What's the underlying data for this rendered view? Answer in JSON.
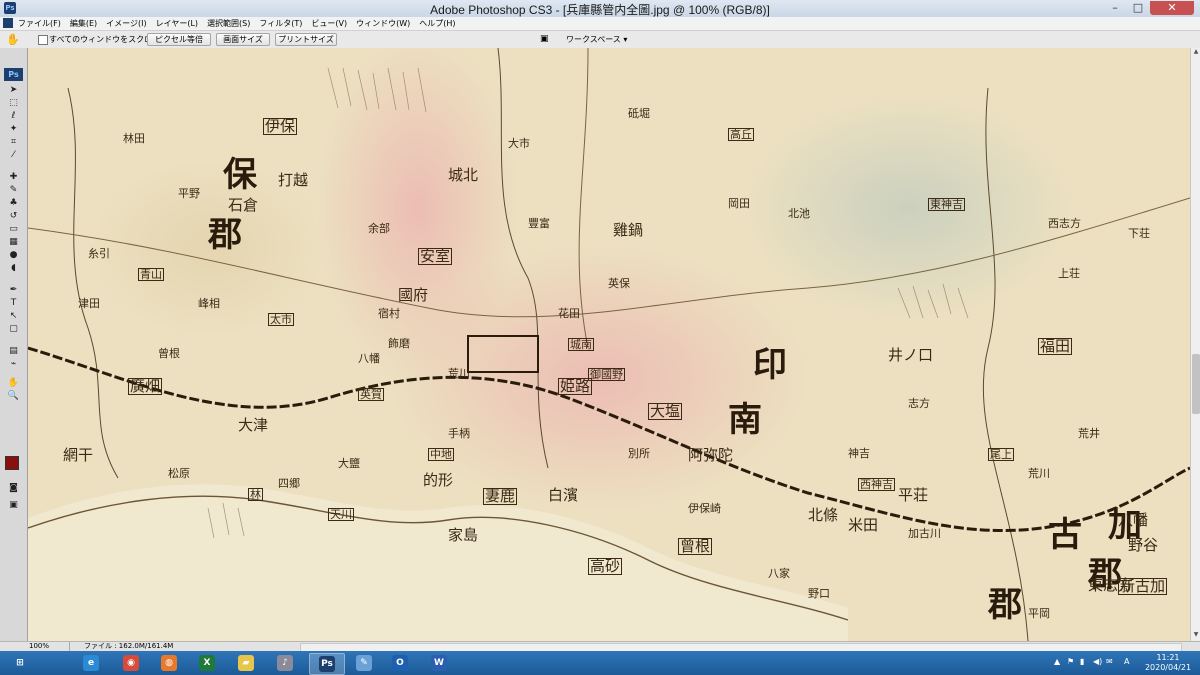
{
  "window": {
    "title": "Adobe Photoshop CS3 - [兵庫縣管内全圖.jpg @ 100% (RGB/8)]",
    "min_glyph": "–",
    "max_glyph": "□",
    "close_glyph": "✕"
  },
  "menubar": {
    "items": [
      "ファイル(F)",
      "編集(E)",
      "イメージ(I)",
      "レイヤー(L)",
      "選択範囲(S)",
      "フィルタ(T)",
      "ビュー(V)",
      "ウィンドウ(W)",
      "ヘルプ(H)"
    ]
  },
  "options": {
    "scroll_all_label": "すべてのウィンドウをスクロール",
    "actual_pixels": "ピクセル等倍",
    "fit_screen": "画面サイズ",
    "print_size": "プリントサイズ",
    "workspace": "ワークスペース ▾"
  },
  "tools": {
    "ps_logo": "Ps",
    "items": [
      {
        "name": "move-tool-icon",
        "glyph": "➤"
      },
      {
        "name": "marquee-tool-icon",
        "glyph": "⬚"
      },
      {
        "name": "lasso-tool-icon",
        "glyph": "ℓ"
      },
      {
        "name": "magic-wand-icon",
        "glyph": "✦"
      },
      {
        "name": "crop-tool-icon",
        "glyph": "⌗"
      },
      {
        "name": "slice-tool-icon",
        "glyph": "⁄"
      },
      {
        "name": "healing-brush-icon",
        "glyph": "✚"
      },
      {
        "name": "brush-tool-icon",
        "glyph": "✎"
      },
      {
        "name": "clone-stamp-icon",
        "glyph": "♣"
      },
      {
        "name": "history-brush-icon",
        "glyph": "↺"
      },
      {
        "name": "eraser-tool-icon",
        "glyph": "▭"
      },
      {
        "name": "gradient-tool-icon",
        "glyph": "▦"
      },
      {
        "name": "blur-tool-icon",
        "glyph": "●"
      },
      {
        "name": "dodge-tool-icon",
        "glyph": "◖"
      },
      {
        "name": "pen-tool-icon",
        "glyph": "✒"
      },
      {
        "name": "type-tool-icon",
        "glyph": "T"
      },
      {
        "name": "path-select-icon",
        "glyph": "↖"
      },
      {
        "name": "shape-tool-icon",
        "glyph": "▢"
      },
      {
        "name": "notes-tool-icon",
        "glyph": "▤"
      },
      {
        "name": "eyedropper-icon",
        "glyph": "⌁"
      },
      {
        "name": "hand-tool-icon",
        "glyph": "✋"
      },
      {
        "name": "zoom-tool-icon",
        "glyph": "🔍"
      }
    ],
    "bottom": [
      {
        "name": "quick-mask-icon",
        "glyph": "◙"
      },
      {
        "name": "screen-mode-icon",
        "glyph": "▣"
      }
    ],
    "foreground_color": "#8a1010",
    "background_color": "#ffffff"
  },
  "status": {
    "zoom": "100%",
    "file_info": "ファイル : 162.0M/161.4M"
  },
  "taskbar": {
    "apps": [
      {
        "name": "start-button",
        "glyph": "⊞",
        "color": "transparent",
        "active": false
      },
      {
        "name": "ie-icon",
        "glyph": "e",
        "color": "#2a8ad6",
        "active": false
      },
      {
        "name": "chrome-icon",
        "glyph": "◉",
        "color": "#d84a3a",
        "active": false
      },
      {
        "name": "firefox-icon",
        "glyph": "◍",
        "color": "#e8782a",
        "active": false
      },
      {
        "name": "excel-icon",
        "glyph": "X",
        "color": "#1f7a3a",
        "active": false
      },
      {
        "name": "explorer-icon",
        "glyph": "▰",
        "color": "#e8c64a",
        "active": false
      },
      {
        "name": "itunes-icon",
        "glyph": "♪",
        "color": "#8a8a9a",
        "active": false
      },
      {
        "name": "photoshop-icon",
        "glyph": "Ps",
        "color": "#1c3f6e",
        "active": true
      },
      {
        "name": "paint-icon",
        "glyph": "✎",
        "color": "#6aa2d8",
        "active": false
      },
      {
        "name": "outlook-icon",
        "glyph": "O",
        "color": "#1f5fb0",
        "active": false
      },
      {
        "name": "word-icon",
        "glyph": "W",
        "color": "#2b5fb0",
        "active": false
      }
    ],
    "time": "11:21",
    "date": "2020/04/21",
    "ime": "A",
    "tray_icons": [
      "▲",
      "⚑",
      "▮",
      "◀)",
      "✉"
    ]
  },
  "map": {
    "large_labels": [
      "保",
      "郡",
      "印",
      "南",
      "郡",
      "加",
      "古",
      "郡"
    ],
    "medium_labels": [
      "伊保",
      "打越",
      "石倉",
      "安室",
      "雞鍋",
      "國府",
      "大塩",
      "阿弥陀",
      "大津",
      "曾根",
      "平荘",
      "東志方",
      "新古加",
      "八幡",
      "野谷",
      "福田",
      "井ノ口",
      "城北",
      "廣畑",
      "網干",
      "的形",
      "妻鹿",
      "白濱",
      "家島",
      "高砂",
      "米田",
      "北條",
      "姫路"
    ],
    "small_labels": [
      "林田",
      "太市",
      "余部",
      "八幡",
      "荒川",
      "英賀",
      "飾磨",
      "宿村",
      "手柄",
      "城南",
      "豐富",
      "砥堀",
      "花田",
      "御國野",
      "別所",
      "志方",
      "神吉",
      "西神吉",
      "加古川",
      "野口",
      "平岡",
      "尾上",
      "荒井",
      "伊保崎",
      "荒川",
      "高丘",
      "八家",
      "曾根",
      "松原",
      "中地",
      "英保",
      "岡田",
      "北池",
      "東神吉",
      "西志方",
      "上荘",
      "下荘",
      "天川",
      "大鹽",
      "津田",
      "糸引",
      "青山",
      "峰相",
      "大市",
      "平野",
      "林",
      "四郷"
    ]
  }
}
